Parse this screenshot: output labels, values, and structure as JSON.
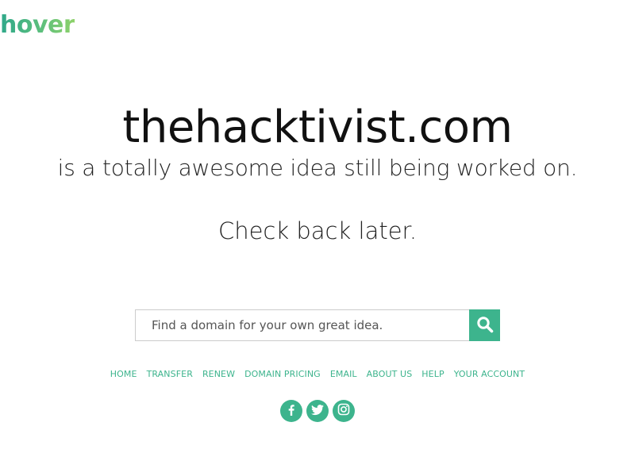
{
  "logo": {
    "text": "hover"
  },
  "hero": {
    "domain": "thehacktivist.com",
    "tagline": "is a totally awesome idea still being worked on.",
    "checkback": "Check back later."
  },
  "search": {
    "placeholder": "Find a domain for your own great idea.",
    "icon": "search-icon"
  },
  "nav": {
    "items": [
      {
        "label": "HOME"
      },
      {
        "label": "TRANSFER"
      },
      {
        "label": "RENEW"
      },
      {
        "label": "DOMAIN PRICING"
      },
      {
        "label": "EMAIL"
      },
      {
        "label": "ABOUT US"
      },
      {
        "label": "HELP"
      },
      {
        "label": "YOUR ACCOUNT"
      }
    ]
  },
  "social": {
    "items": [
      {
        "icon": "facebook-icon"
      },
      {
        "icon": "twitter-icon"
      },
      {
        "icon": "instagram-icon"
      }
    ]
  },
  "colors": {
    "accent": "#3db48d",
    "logo_gradient_start": "#2fa88a",
    "logo_gradient_end": "#8ed26a",
    "text": "#111111"
  }
}
